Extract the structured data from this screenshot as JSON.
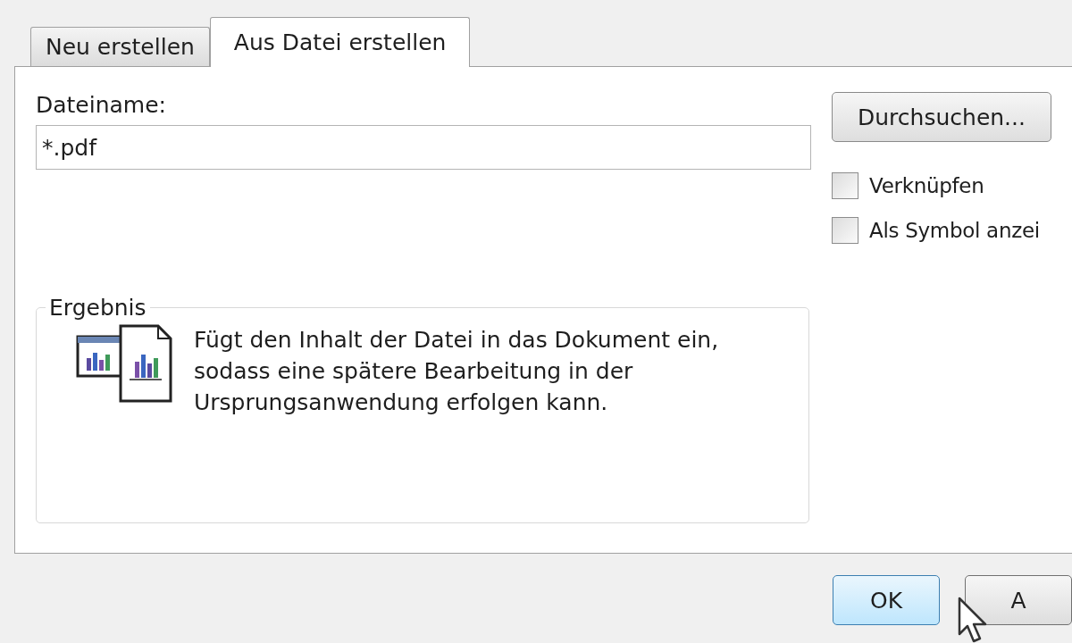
{
  "tabs": [
    {
      "label": "Neu erstellen",
      "selected": false
    },
    {
      "label": "Aus Datei erstellen",
      "selected": true
    }
  ],
  "file_name": {
    "label": "Dateiname:",
    "value": "*.pdf"
  },
  "browse_button": "Durchsuchen...",
  "options": [
    {
      "label": "Verknüpfen",
      "checked": false
    },
    {
      "label": "Als Symbol anzei",
      "checked": false
    }
  ],
  "result": {
    "title": "Ergebnis",
    "text": "Fügt den Inhalt der Datei in das Dokument ein, sodass eine spätere Bearbeitung in der Ursprungsanwendung erfolgen kann."
  },
  "buttons": [
    "OK",
    "A"
  ]
}
